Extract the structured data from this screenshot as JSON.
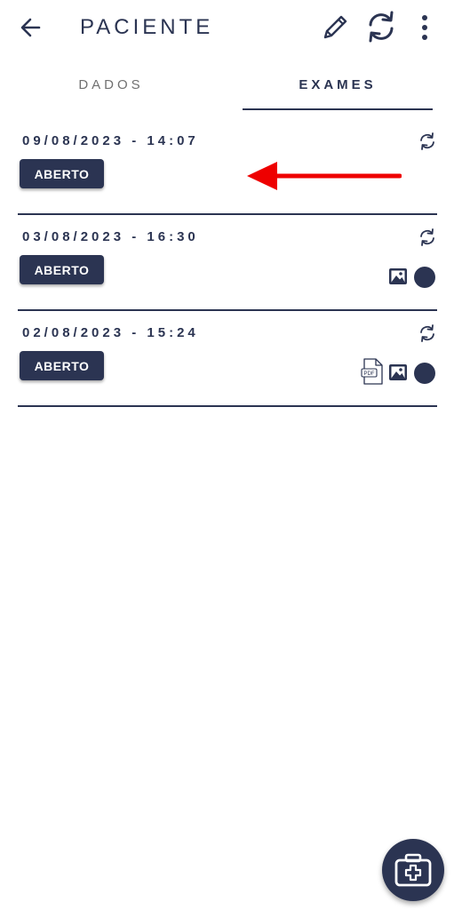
{
  "header": {
    "title": "PACIENTE",
    "back_icon": "arrow-left-icon",
    "edit_icon": "pencil-icon",
    "sync_icon": "sync-icon",
    "more_icon": "more-vertical-icon"
  },
  "tabs": [
    {
      "label": "DADOS",
      "selected": false
    },
    {
      "label": "EXAMES",
      "selected": true
    }
  ],
  "exams": [
    {
      "date": "09/08/2023 - 14:07",
      "status": "ABERTO",
      "attachments": []
    },
    {
      "date": "03/08/2023 - 16:30",
      "status": "ABERTO",
      "attachments": [
        "image-icon",
        "status-dot-icon"
      ]
    },
    {
      "date": "02/08/2023 - 15:24",
      "status": "ABERTO",
      "attachments": [
        "pdf-icon",
        "image-icon",
        "status-dot-icon"
      ]
    }
  ],
  "annotation": {
    "icon": "red-arrow-left-icon",
    "color": "#ee0000"
  },
  "fab": {
    "icon": "medical-kit-icon"
  },
  "colors": {
    "primary": "#2b3452",
    "tab_inactive": "#707070",
    "background": "#ffffff"
  }
}
